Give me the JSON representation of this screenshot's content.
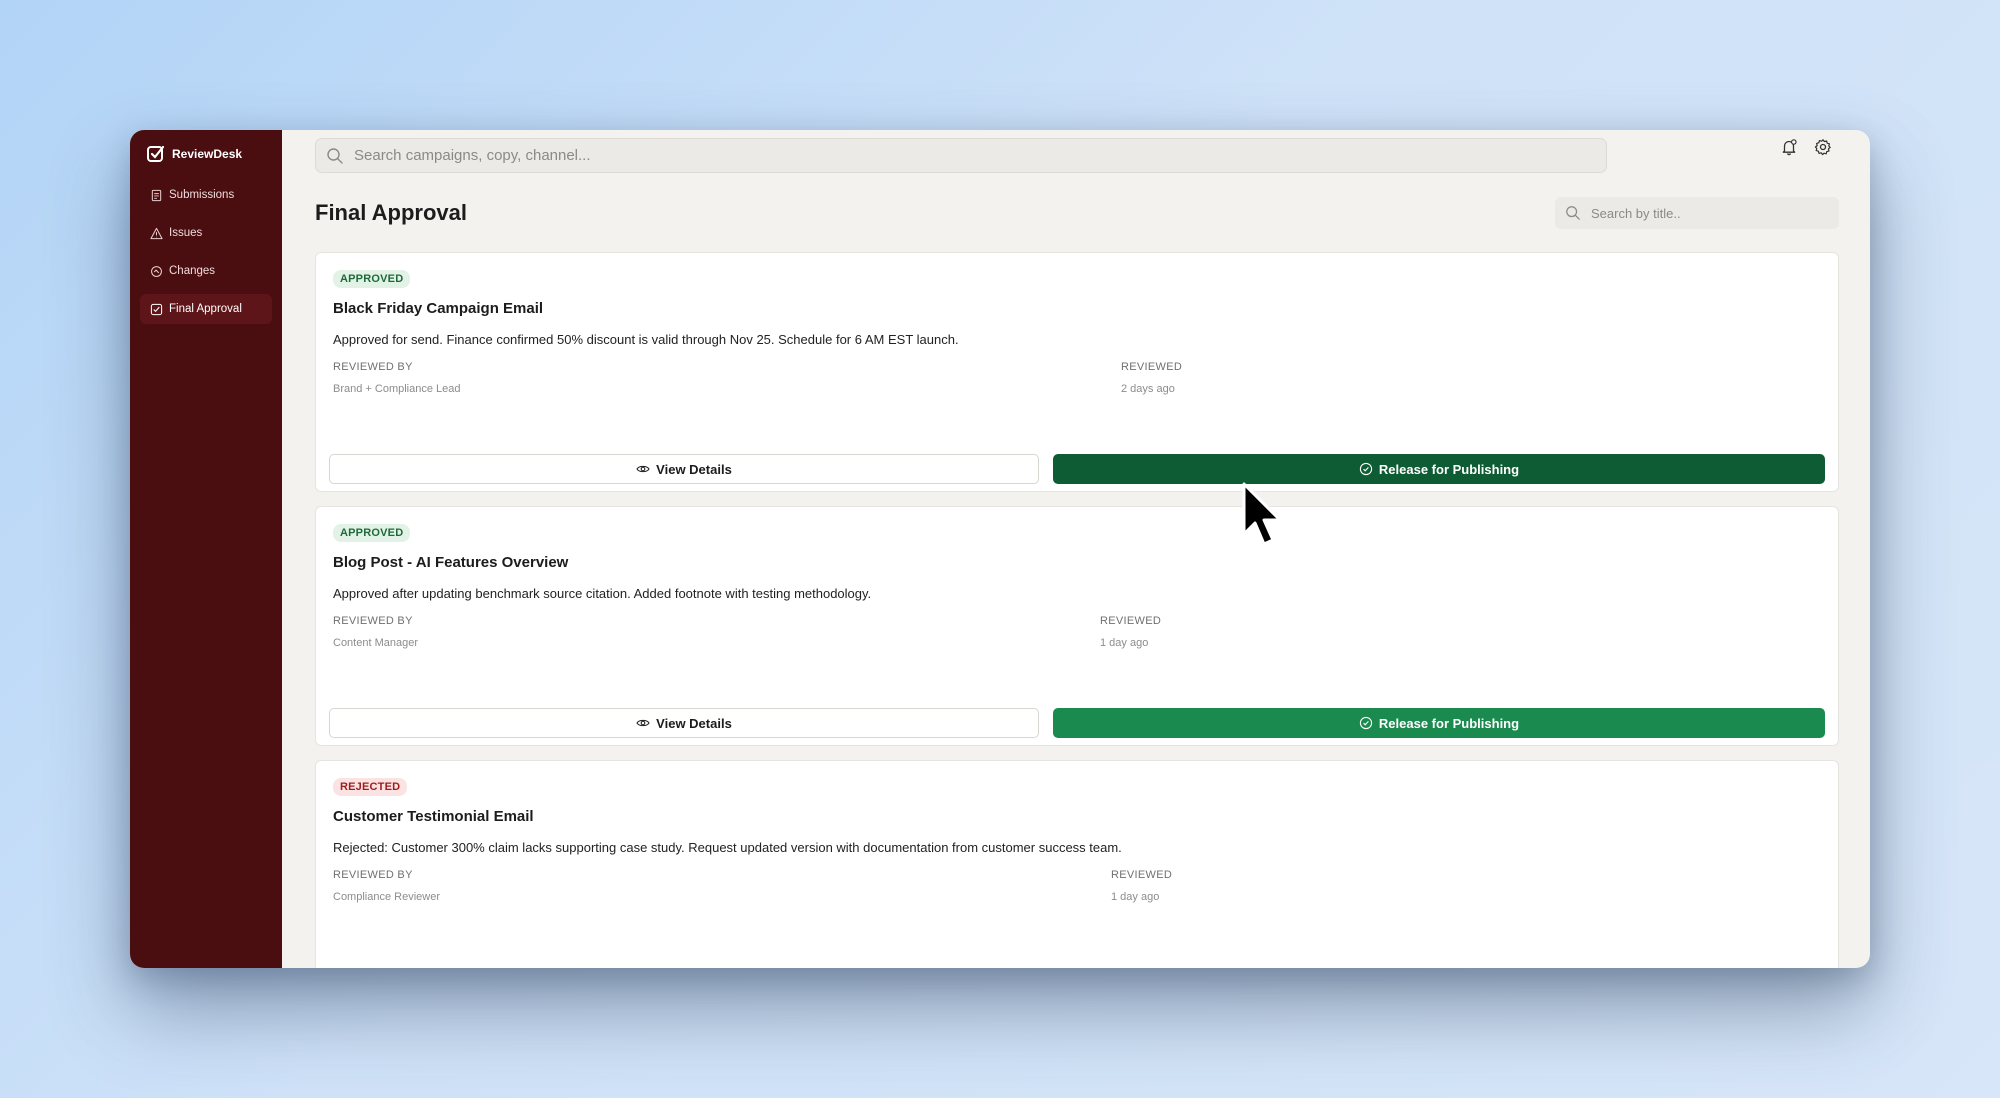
{
  "app": {
    "name": "ReviewDesk"
  },
  "sidebar": {
    "items": [
      {
        "label": "Submissions",
        "icon": "clipboard-icon"
      },
      {
        "label": "Issues",
        "icon": "warning-icon"
      },
      {
        "label": "Changes",
        "icon": "changes-icon"
      },
      {
        "label": "Final Approval",
        "icon": "check-square-icon",
        "active": true
      }
    ]
  },
  "search": {
    "placeholder": "Search campaigns, copy, channel..."
  },
  "page": {
    "title": "Final Approval",
    "title_search_placeholder": "Search by title.."
  },
  "cards": [
    {
      "status": "APPROVED",
      "title": "Black Friday Campaign Email",
      "description": "Approved for send. Finance confirmed 50% discount is valid through Nov 25. Schedule for 6 AM EST launch.",
      "reviewed_by_label": "REVIEWED BY",
      "reviewed_by": "Brand + Compliance Lead",
      "reviewed_label": "REVIEWED",
      "reviewed": "2 days ago",
      "view_label": "View Details",
      "release_label": "Release for Publishing"
    },
    {
      "status": "APPROVED",
      "title": "Blog Post - AI Features Overview",
      "description": "Approved after updating benchmark source citation. Added footnote with testing methodology.",
      "reviewed_by_label": "REVIEWED BY",
      "reviewed_by": "Content Manager",
      "reviewed_label": "REVIEWED",
      "reviewed": "1 day ago",
      "view_label": "View Details",
      "release_label": "Release for Publishing"
    },
    {
      "status": "REJECTED",
      "title": "Customer Testimonial Email",
      "description": "Rejected: Customer 300% claim lacks supporting case study. Request updated version with documentation from customer success team.",
      "reviewed_by_label": "REVIEWED BY",
      "reviewed_by": "Compliance Reviewer",
      "reviewed_label": "REVIEWED",
      "reviewed": "1 day ago"
    }
  ],
  "colors": {
    "sidebar": "#4a0d10",
    "release_button": "#1a8a4f",
    "release_button_hover": "#0d5c33"
  }
}
